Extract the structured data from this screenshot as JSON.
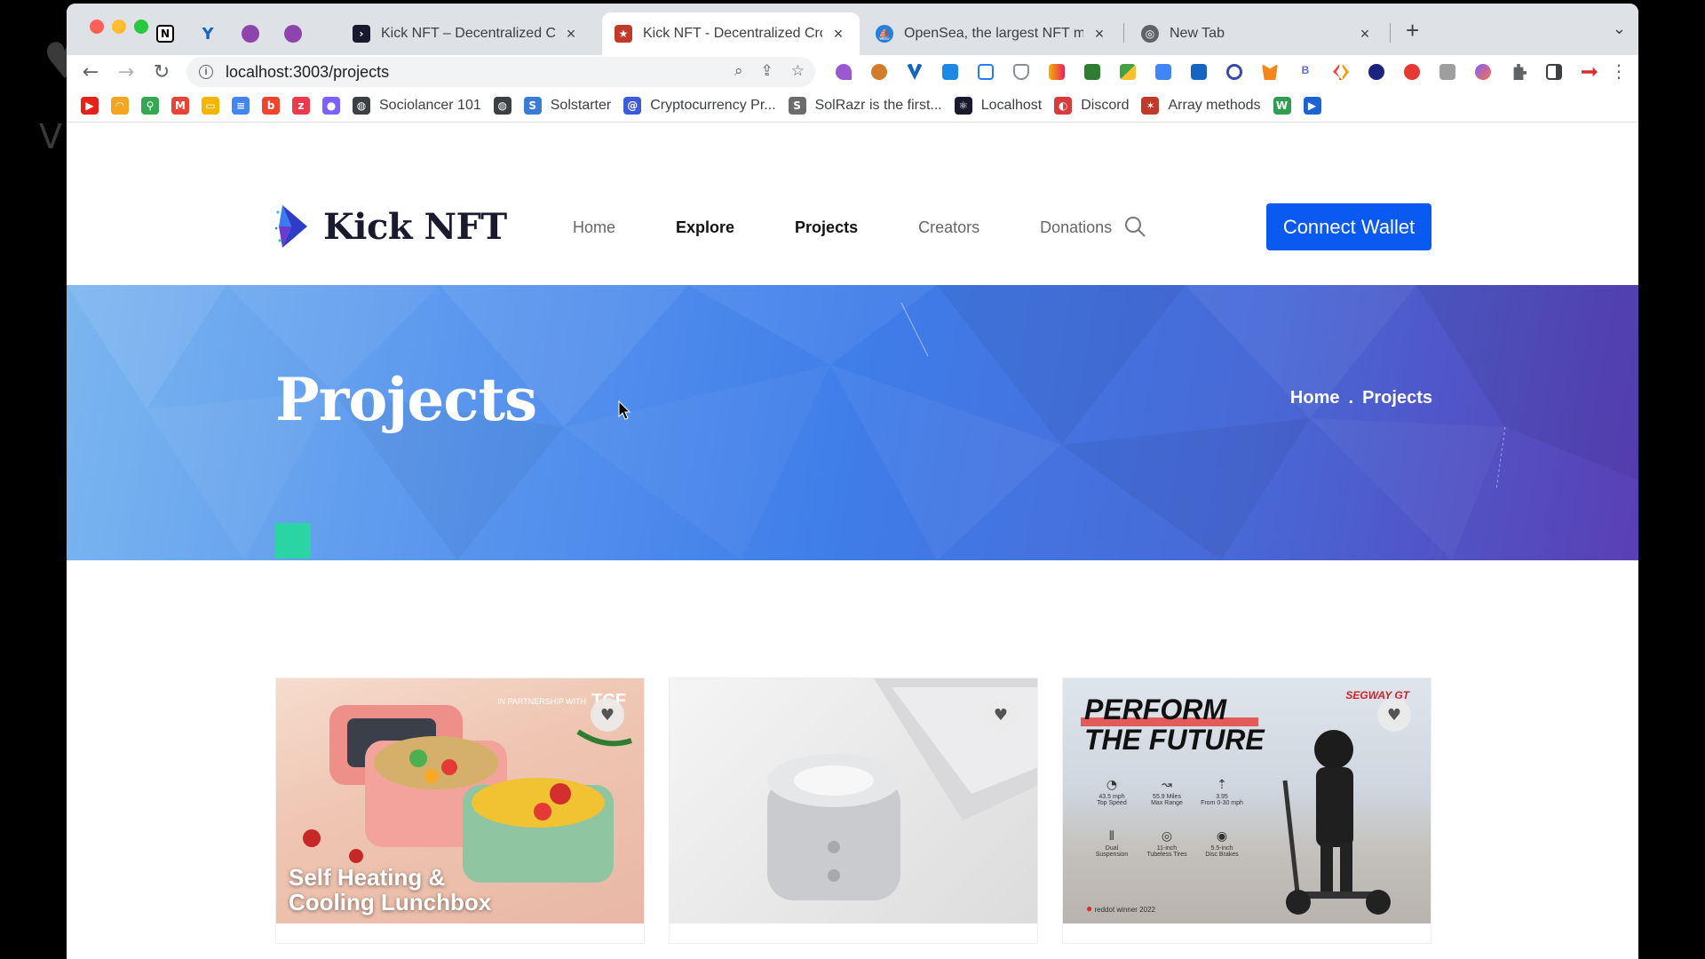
{
  "window": {
    "tabs": [
      {
        "title": "Kick NFT – Decentralized Crow",
        "active": false
      },
      {
        "title": "Kick NFT - Decentralized Crow",
        "active": true
      },
      {
        "title": "OpenSea, the largest NFT mark",
        "active": false
      },
      {
        "title": "New Tab",
        "active": false
      }
    ],
    "pinned_tabs": [
      "notion-icon",
      "vee-icon",
      "podcast-icon",
      "podcast-icon-2"
    ]
  },
  "toolbar": {
    "url": "localhost:3003/projects"
  },
  "bookmarks": [
    {
      "label": "",
      "icon": "youtube-icon",
      "color": "#e62117"
    },
    {
      "label": "",
      "icon": "rainbow-icon",
      "color": "#f4a521"
    },
    {
      "label": "",
      "icon": "maps-icon",
      "color": "#34a853"
    },
    {
      "label": "",
      "icon": "gmail-icon",
      "color": "#ea4335"
    },
    {
      "label": "",
      "icon": "slides-icon",
      "color": "#f4b400"
    },
    {
      "label": "",
      "icon": "docs-icon",
      "color": "#4285f4"
    },
    {
      "label": "",
      "icon": "b-icon",
      "color": "#f0442f"
    },
    {
      "label": "",
      "icon": "zazzle-icon",
      "color": "#ec3a4b"
    },
    {
      "label": "",
      "icon": "circles-icon",
      "color": "#7b61ff"
    },
    {
      "label": "Sociolancer 101",
      "icon": "globe-icon",
      "color": "#3c4043"
    },
    {
      "label": "",
      "icon": "globe-icon",
      "color": "#3c4043"
    },
    {
      "label": "Solstarter",
      "icon": "solstarter-icon",
      "color": "#3a7bd5"
    },
    {
      "label": "Cryptocurrency Pr...",
      "icon": "at-icon",
      "color": "#3b5bdb"
    },
    {
      "label": "SolRazr is the first...",
      "icon": "s-icon",
      "color": "#6c6c6c"
    },
    {
      "label": "Localhost",
      "icon": "react-icon",
      "color": "#1a1a2e"
    },
    {
      "label": "Discord",
      "icon": "discord-icon",
      "color": "#d83b3b"
    },
    {
      "label": "Array methods",
      "icon": "person-icon",
      "color": "#c0392b"
    },
    {
      "label": "",
      "icon": "w-icon",
      "color": "#2e9e4f"
    },
    {
      "label": "",
      "icon": "play-icon",
      "color": "#1c63d6"
    }
  ],
  "site": {
    "brand": "Kick NFT",
    "nav": [
      {
        "label": "Home",
        "active": false
      },
      {
        "label": "Explore",
        "active": true
      },
      {
        "label": "Projects",
        "active": true
      },
      {
        "label": "Creators",
        "active": false
      },
      {
        "label": "Donations",
        "active": false
      }
    ],
    "connect_label": "Connect Wallet"
  },
  "hero": {
    "title": "Projects",
    "breadcrumb": [
      "Home",
      ".",
      "Projects"
    ]
  },
  "cards": [
    {
      "image": "lunchbox-photo",
      "overlay_line1": "Self Heating &",
      "overlay_line2": "Cooling Lunchbox",
      "partner_small": "IN PARTNERSHIP WITH",
      "partner_logo": "TCF"
    },
    {
      "image": "speaker-photo"
    },
    {
      "image": "scooter-photo",
      "headline_1": "PERFORM",
      "headline_2": "THE FUTURE",
      "brand_mark": "SEGWAY GT",
      "specs": [
        {
          "value": "43.5 mph",
          "label": "Top Speed"
        },
        {
          "value": "55.9 Miles",
          "label": "Max Range"
        },
        {
          "value": "3.95",
          "label": "From 0-30 mph"
        },
        {
          "value": "Dual",
          "label": "Suspension"
        },
        {
          "value": "11-inch",
          "label": "Tubeless Tires"
        },
        {
          "value": "5.5-inch",
          "label": "Disc Brakes"
        }
      ],
      "award": "reddot winner 2022"
    }
  ],
  "colors": {
    "accent": "#0a59f0",
    "hero_square": "#2ad4a3"
  }
}
